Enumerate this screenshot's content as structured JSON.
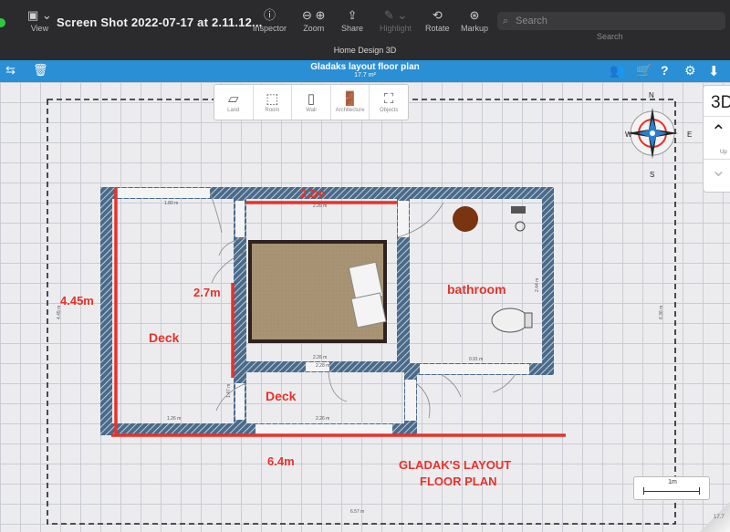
{
  "titlebar": {
    "view_label": "View",
    "document_title": "Screen Shot 2022-07-17 at 2.11.12...",
    "tools": [
      {
        "label": "Inspector",
        "icon": "info-icon"
      },
      {
        "label": "Zoom",
        "icon": "zoom-icon"
      },
      {
        "label": "Share",
        "icon": "share-icon"
      },
      {
        "label": "Highlight",
        "icon": "highlight-icon"
      },
      {
        "label": "Rotate",
        "icon": "rotate-icon"
      },
      {
        "label": "Markup",
        "icon": "markup-icon"
      }
    ],
    "search_placeholder": "Search",
    "search_label": "Search",
    "app_name": "Home Design 3D"
  },
  "app": {
    "plan_title": "Gladaks layout floor plan",
    "plan_area": "17.7 m²"
  },
  "object_toolbar": {
    "items": [
      {
        "label": "Land",
        "icon": "land-icon"
      },
      {
        "label": "Room",
        "icon": "room-icon"
      },
      {
        "label": "Wall",
        "icon": "wall-icon"
      },
      {
        "label": "Architecture",
        "icon": "door-icon"
      },
      {
        "label": "Objects",
        "icon": "armchair-icon"
      }
    ]
  },
  "view_panel": {
    "mode": "3D",
    "up_label": "Up"
  },
  "compass": {
    "n": "N",
    "s": "S",
    "e": "E",
    "w": "W"
  },
  "floorplan": {
    "annotations": {
      "top_width": "2.2m",
      "left_height": "4.45m",
      "inner_height": "2.7m",
      "bottom_width": "6.4m",
      "deck_left": "Deck",
      "deck_bottom": "Deck",
      "bathroom": "bathroom",
      "caption_line1": "GLADAK'S LAYOUT",
      "caption_line2": "FLOOR PLAN"
    },
    "small_dims": {
      "d1": "1.80 m",
      "d2": "2.26 m",
      "d3": "2.26 m",
      "d4": "1.26 m",
      "d5": "2.26 m",
      "d6": "0.91 m",
      "d7": "4.45 m",
      "d8": "6.36 m",
      "d9": "6.57 m",
      "d10": "2.44 m",
      "d11": "2.28 m",
      "d12": "1.47 m"
    }
  },
  "scale_bar": {
    "label": "1m"
  },
  "corner_readout": "17.7",
  "colors": {
    "header_blue": "#2a8fd4",
    "annotation_red": "#e8322a",
    "wall_blue": "#4a6a8a"
  }
}
